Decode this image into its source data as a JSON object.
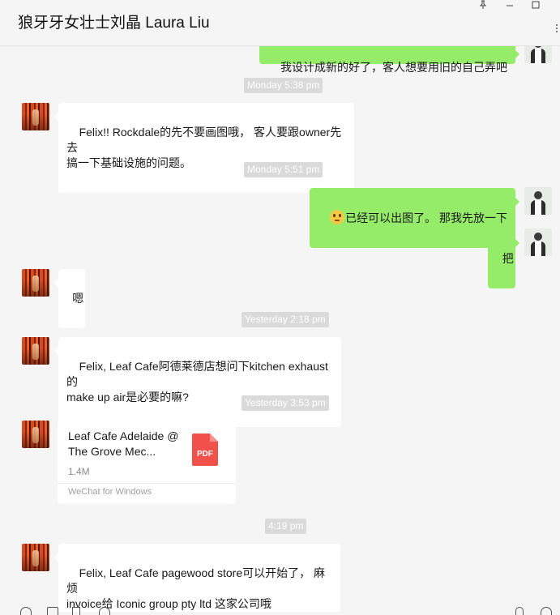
{
  "header": {
    "title": "狼牙牙女壮士刘晶 Laura Liu",
    "controls": {
      "pin": "pin-icon",
      "minimize": "minimize-icon",
      "maximize": "maximize-icon"
    }
  },
  "messages": {
    "m1": {
      "text": "我设计成新的好了，客人想要用旧的自己弄吧"
    },
    "ts1": "Monday 5:38 pm",
    "m2": {
      "text": "Felix!! Rockdale的先不要画图哦， 客人要跟owner先去\n搞一下基础设施的问题。"
    },
    "ts2": "Monday 5:51 pm",
    "m3": {
      "emoji": "rolling-eyes-emoji",
      "text": "已经可以出图了。 那我先放一下"
    },
    "m4": {
      "text": "把"
    },
    "m5": {
      "text": "嗯"
    },
    "ts3": "Yesterday 2:18 pm",
    "m6": {
      "text": "Felix, Leaf Cafe阿德莱德店想问下kitchen exhaust的\nmake up air是必要的嘛?"
    },
    "ts4": "Yesterday 3:53 pm",
    "file": {
      "name": "Leaf Cafe Adelaide @ The Grove Mec...",
      "size": "1.4M",
      "source": "WeChat for Windows",
      "type_label": "PDF",
      "icon": "pdf-file-icon"
    },
    "ts5": "4:19 pm",
    "m7": {
      "text": "Felix, Leaf Cafe pagewood store可以开始了， 麻烦\ninvoice给 Iconic group pty ltd 这家公司哦"
    }
  },
  "colors": {
    "outgoing_bubble": "#95ec69",
    "incoming_bubble": "#ffffff",
    "timestamp_bg": "#dadada",
    "background": "#f5f5f5",
    "pdf_red": "#f2504b"
  }
}
